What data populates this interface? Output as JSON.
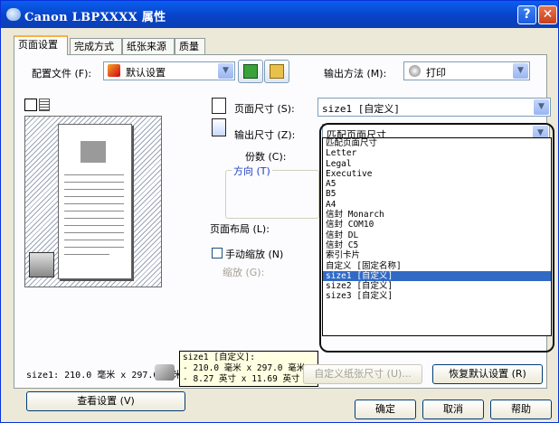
{
  "window": {
    "title": "Canon LBPXXXX 属性",
    "help_glyph": "?",
    "close_glyph": "✕"
  },
  "tabs": [
    {
      "label": "页面设置",
      "active": true
    },
    {
      "label": "完成方式",
      "active": false
    },
    {
      "label": "纸张来源",
      "active": false
    },
    {
      "label": "质量",
      "active": false
    }
  ],
  "profile": {
    "label": "配置文件 (F):",
    "value": "默认设置",
    "arrow": "▼"
  },
  "output_method": {
    "label": "输出方法 (M):",
    "value": "打印"
  },
  "page_size": {
    "label": "页面尺寸 (S):",
    "value": "size1 [自定义]"
  },
  "output_size": {
    "label": "输出尺寸 (Z):",
    "value": "匹配页面尺寸"
  },
  "copies": {
    "label": "份数 (C):"
  },
  "orientation": {
    "label": "方向 (T)"
  },
  "page_layout": {
    "label": "页面布局 (L):"
  },
  "manual_scaling": {
    "label": "手动缩放 (N)",
    "checked": false
  },
  "scaling": {
    "label": "缩放 (G):"
  },
  "preview": {
    "size_text": "size1: 210.0 毫米 x 297.0 毫米"
  },
  "view_settings_button": "查看设置 (V)",
  "dropdown_items": [
    {
      "text": "匹配页面尺寸",
      "selected": false
    },
    {
      "text": "Letter",
      "selected": false
    },
    {
      "text": "Legal",
      "selected": false
    },
    {
      "text": "Executive",
      "selected": false
    },
    {
      "text": "A5",
      "selected": false
    },
    {
      "text": "B5",
      "selected": false
    },
    {
      "text": "A4",
      "selected": false
    },
    {
      "text": "信封 Monarch",
      "selected": false
    },
    {
      "text": "信封 COM10",
      "selected": false
    },
    {
      "text": "信封 DL",
      "selected": false
    },
    {
      "text": "信封 C5",
      "selected": false
    },
    {
      "text": "索引卡片",
      "selected": false
    },
    {
      "text": "自定义 [固定名称]",
      "selected": false
    },
    {
      "text": "size1 [自定义]",
      "selected": true
    },
    {
      "text": "size2 [自定义]",
      "selected": false
    },
    {
      "text": "size3 [自定义]",
      "selected": false
    }
  ],
  "tooltip_lines": [
    "size1 [自定义]:",
    " - 210.0 毫米 x 297.0 毫米",
    " - 8.27 英寸 x 11.69 英寸"
  ],
  "custom_paper_button": "自定义纸张尺寸 (U)...",
  "restore_defaults_button": "恢复默认设置 (R)",
  "ok_button": "确定",
  "cancel_button": "取消",
  "help_button": "帮助"
}
